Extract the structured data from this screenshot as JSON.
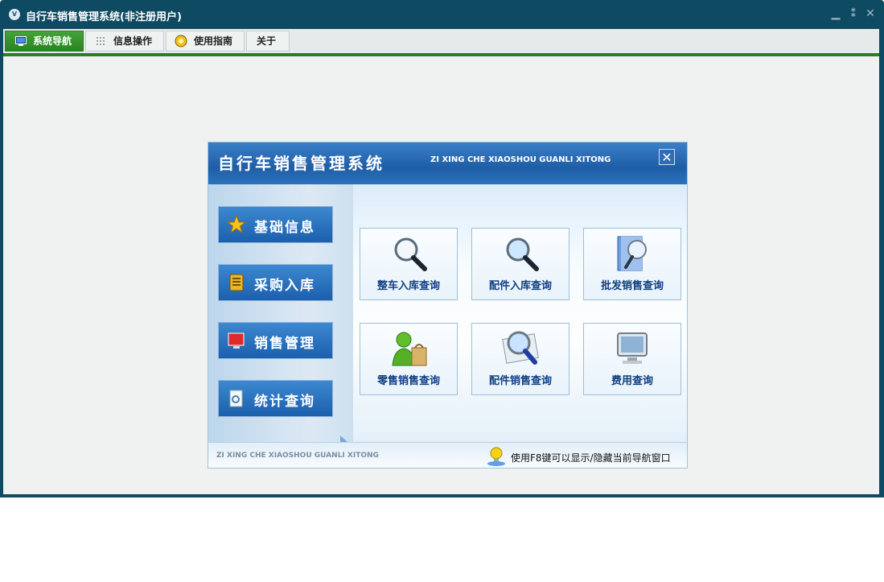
{
  "window": {
    "title": "自行车销售管理系统(非注册用户)",
    "app_icon_text": "V",
    "controls": [
      "minimize",
      "restore",
      "close"
    ]
  },
  "menu": {
    "items": [
      {
        "label": "系统导航",
        "icon": "monitor-icon",
        "active": true
      },
      {
        "label": "信息操作",
        "icon": "grid-icon",
        "active": false
      },
      {
        "label": "使用指南",
        "icon": "help-icon",
        "active": false
      },
      {
        "label": "关于",
        "icon": "",
        "active": false
      }
    ]
  },
  "nav_panel": {
    "title": "自行车销售管理系统",
    "pinyin": "ZI XING CHE XIAOSHOU GUANLI XITONG",
    "close_label": "✕",
    "categories": [
      {
        "label": "基础信息",
        "icon": "star-icon"
      },
      {
        "label": "采购入库",
        "icon": "ledger-icon"
      },
      {
        "label": "销售管理",
        "icon": "monitor-icon"
      },
      {
        "label": "统计查询",
        "icon": "document-search-icon"
      }
    ],
    "tiles": [
      {
        "label": "整车入库查询",
        "icon": "magnifier-icon"
      },
      {
        "label": "配件入库查询",
        "icon": "magnifier-icon"
      },
      {
        "label": "批发销售查询",
        "icon": "book-magnifier-icon"
      },
      {
        "label": "零售销售查询",
        "icon": "user-bag-icon"
      },
      {
        "label": "配件销售查询",
        "icon": "map-magnifier-icon"
      },
      {
        "label": "费用查询",
        "icon": "monitor-icon"
      }
    ],
    "footer_pinyin": "ZI XING CHE XIAOSHOU GUANLI XITONG",
    "footer_tip": "使用F8键可以显示/隐藏当前导航窗口"
  },
  "colors": {
    "window_frame": "#0e4a62",
    "menu_active": "#2c8223",
    "nav_header": "#1f5ea6",
    "tile_text": "#0f3f82"
  }
}
